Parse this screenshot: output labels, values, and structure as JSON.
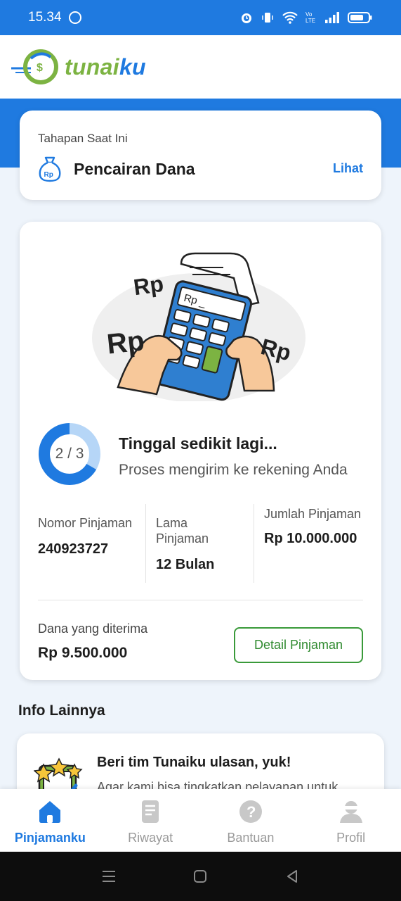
{
  "status_bar": {
    "time": "15.34",
    "icons": [
      "whatsapp-icon",
      "alarm-icon",
      "vibrate-icon",
      "wifi-icon",
      "volte-icon",
      "signal-icon",
      "battery-icon"
    ]
  },
  "header": {
    "logo_part1": "tunai",
    "logo_part2": "ku",
    "colors": {
      "brand_green": "#7cb342",
      "brand_blue": "#1f7ae0"
    }
  },
  "stage_card": {
    "caption": "Tahapan Saat Ini",
    "title": "Pencairan Dana",
    "link": "Lihat",
    "icon": "money-bag-icon"
  },
  "loan_card": {
    "illustration_labels": [
      "Rp",
      "Rp",
      "Rp",
      "Rp _"
    ],
    "progress": {
      "label": "2 / 3",
      "current": 2,
      "total": 3
    },
    "progress_title": "Tinggal sedikit lagi...",
    "progress_sub": "Proses mengirim ke rekening Anda",
    "loan_number_label": "Nomor Pinjaman",
    "loan_number_value": "240923727",
    "duration_label": "Lama Pinjaman",
    "duration_value": "12 Bulan",
    "amount_label": "Jumlah Pinjaman",
    "amount_value": "Rp 10.000.000",
    "received_label": "Dana yang diterima",
    "received_value": "Rp 9.500.000",
    "detail_button": "Detail Pinjaman"
  },
  "info_section": {
    "title": "Info Lainnya",
    "review_title": "Beri tim Tunaiku ulasan, yuk!",
    "review_sub": "Agar kami bisa tingkatkan pelayanan untuk"
  },
  "bottom_nav": {
    "items": [
      {
        "label": "Pinjamanku",
        "icon": "home-icon",
        "active": true
      },
      {
        "label": "Riwayat",
        "icon": "history-icon",
        "active": false
      },
      {
        "label": "Bantuan",
        "icon": "help-icon",
        "active": false
      },
      {
        "label": "Profil",
        "icon": "profile-icon",
        "active": false
      }
    ]
  },
  "system_nav": [
    "menu-icon",
    "home-square-icon",
    "back-icon"
  ]
}
